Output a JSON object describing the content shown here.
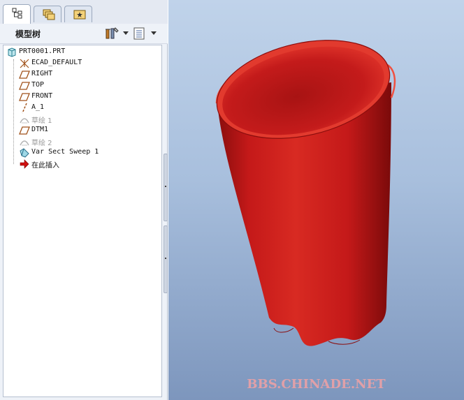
{
  "tabs": [
    {
      "name": "model-tree-tab",
      "icon": "model-tree-icon"
    },
    {
      "name": "layers-tab",
      "icon": "layers-icon"
    },
    {
      "name": "favorites-tab",
      "icon": "favorites-icon"
    }
  ],
  "tree_panel": {
    "title": "模型树",
    "settings_icon": "tools-icon",
    "show_icon": "list-icon"
  },
  "tree": {
    "root": "PRT0001.PRT",
    "items": [
      {
        "label": "ECAD_DEFAULT",
        "icon": "coordinate-system-icon"
      },
      {
        "label": "RIGHT",
        "icon": "datum-plane-icon"
      },
      {
        "label": "TOP",
        "icon": "datum-plane-icon"
      },
      {
        "label": "FRONT",
        "icon": "datum-plane-icon"
      },
      {
        "label": "A_1",
        "icon": "datum-axis-icon"
      },
      {
        "label": "草绘 1",
        "icon": "sketch-icon"
      },
      {
        "label": "DTM1",
        "icon": "datum-plane-icon"
      },
      {
        "label": "草绘 2",
        "icon": "sketch-icon"
      },
      {
        "label": "Var Sect Sweep 1",
        "icon": "sweep-feature-icon"
      },
      {
        "label": "在此插入",
        "icon": "insert-arrow-icon"
      }
    ]
  },
  "colors": {
    "model_red": "#c41919",
    "viewport_top": "#c0d3ea",
    "viewport_bottom": "#7d96bd"
  },
  "watermark": "BBS.CHINADE.NET"
}
